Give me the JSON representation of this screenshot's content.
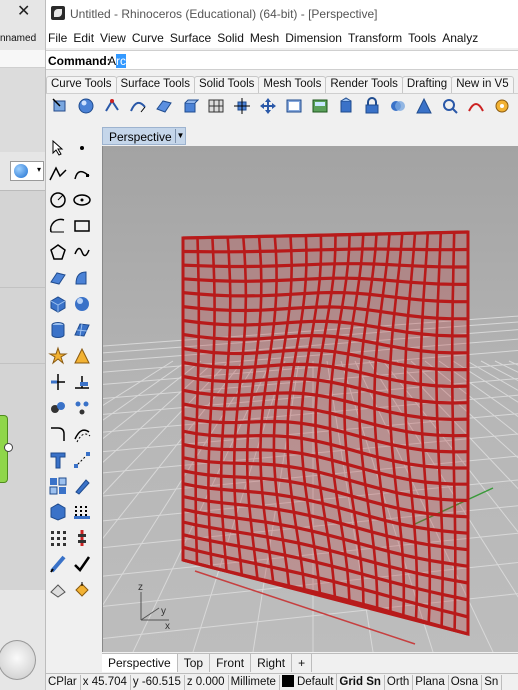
{
  "left_window": {
    "close_glyph": "✕",
    "tab_label": "nnamed"
  },
  "title": "Untitled - Rhinoceros (Educational) (64-bit) - [Perspective]",
  "menu": [
    "File",
    "Edit",
    "View",
    "Curve",
    "Surface",
    "Solid",
    "Mesh",
    "Dimension",
    "Transform",
    "Tools",
    "Analyz"
  ],
  "command": {
    "label": "Command:",
    "typed": "A",
    "selected": "rc"
  },
  "toolbar_tabs": [
    "Curve Tools",
    "Surface Tools",
    "Solid Tools",
    "Mesh Tools",
    "Render Tools",
    "Drafting",
    "New in V5"
  ],
  "viewport": {
    "title": "Perspective",
    "axis_z": "z",
    "axis_x": "x",
    "axis_y": "y",
    "colors": {
      "object": "#b81a1a",
      "background_top": "#a3a3a3",
      "grid": "#d8d8d8"
    }
  },
  "viewport_tabs": [
    "Perspective",
    "Top",
    "Front",
    "Right",
    "+"
  ],
  "status": {
    "cplane": "CPlar",
    "x": "x 45.704",
    "y": "y -60.515",
    "z": "z 0.000",
    "units": "Millimete",
    "layer": "Default",
    "grid_snap": "Grid Sn",
    "ortho": "Orth",
    "planar": "Plana",
    "osnap": "Osna",
    "smart": "Sn"
  }
}
